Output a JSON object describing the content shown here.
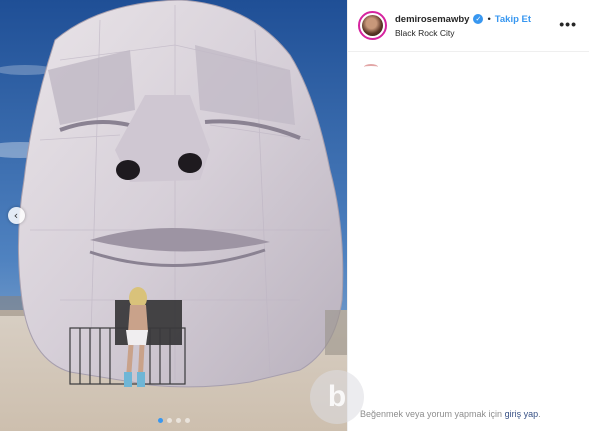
{
  "post": {
    "username": "demirosemawby",
    "separator": "•",
    "follow_label": "Takip Et",
    "location": "Black Rock City",
    "more_glyph": "•••"
  },
  "carousel": {
    "prev_glyph": "‹",
    "slide_count": 4,
    "active_index": 0
  },
  "footer": {
    "login_prefix": "Beğenmek veya yorum yapmak için ",
    "login_link": "giriş yap",
    "login_suffix": "."
  },
  "colors": {
    "accent": "#3897f0",
    "sky": "#2f62a8",
    "sand": "#d9cfc2"
  },
  "icons": [
    "verified-icon",
    "chevron-left-icon",
    "more-options-icon"
  ]
}
